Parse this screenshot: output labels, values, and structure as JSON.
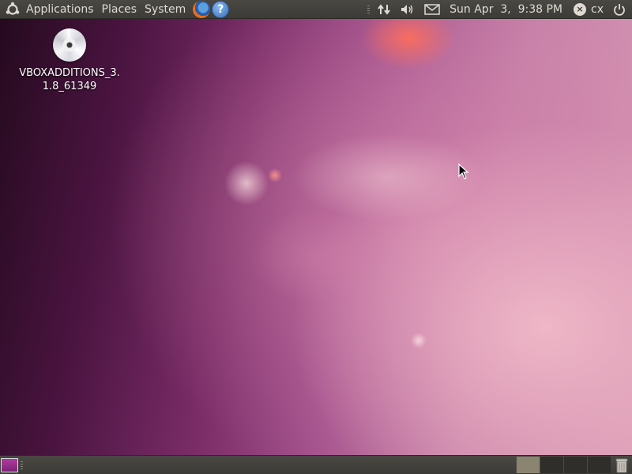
{
  "top_panel": {
    "menus": [
      "Applications",
      "Places",
      "System"
    ],
    "launchers": [
      "firefox-icon",
      "help-icon"
    ],
    "clock": "Sun Apr  3,  9:38 PM",
    "user": "cx"
  },
  "desktop": {
    "icons": [
      {
        "label": "VBOXADDITIONS_3.1.8_61349",
        "icon": "cd-icon"
      }
    ]
  },
  "bottom_panel": {
    "workspaces": 4,
    "active_workspace": 1
  },
  "colors": {
    "panel": "#3c3b37",
    "panel_text": "#dfdbd2"
  }
}
